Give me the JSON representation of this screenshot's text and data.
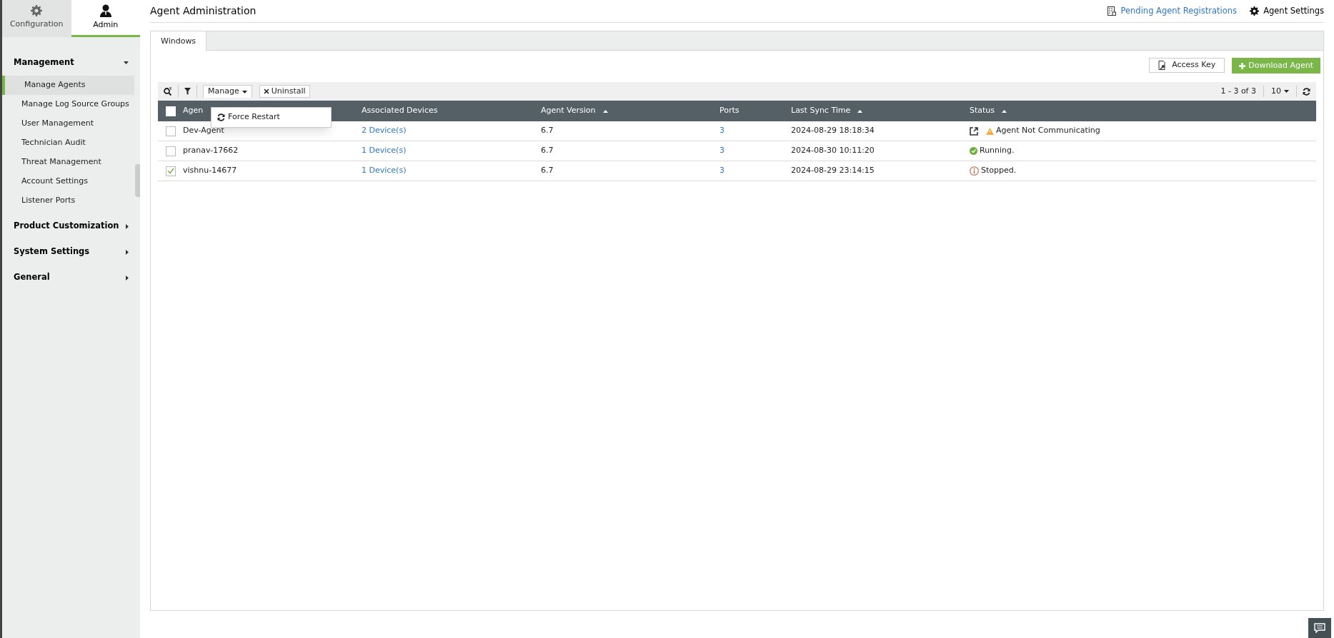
{
  "top_tabs": [
    {
      "label": "Configuration",
      "selected": false
    },
    {
      "label": "Admin",
      "selected": true
    }
  ],
  "sidebar": {
    "sections": [
      {
        "label": "Management",
        "expanded": true,
        "items": [
          {
            "label": "Manage Agents",
            "selected": true
          },
          {
            "label": "Manage Log Source Groups",
            "selected": false
          },
          {
            "label": "User Management",
            "selected": false
          },
          {
            "label": "Technician Audit",
            "selected": false
          },
          {
            "label": "Threat Management",
            "selected": false
          },
          {
            "label": "Account Settings",
            "selected": false
          },
          {
            "label": "Listener Ports",
            "selected": false
          }
        ]
      },
      {
        "label": "Product Customization",
        "expanded": false
      },
      {
        "label": "System Settings",
        "expanded": false
      },
      {
        "label": "General",
        "expanded": false
      }
    ]
  },
  "page_title": "Agent Administration",
  "header_links": [
    {
      "label": "Pending Agent Registrations",
      "kind": "link"
    },
    {
      "label": "Agent Settings",
      "kind": "settings"
    }
  ],
  "os_tabs": [
    {
      "label": "Windows",
      "selected": true
    }
  ],
  "buttons": [
    {
      "label": "Access Key",
      "kind": "secondary"
    },
    {
      "label": "Download Agent",
      "kind": "primary"
    }
  ],
  "toolbar": {
    "manage": "Manage",
    "uninstall": "Uninstall",
    "pagination": "1 - 3 of 3",
    "page_size": "10"
  },
  "manage_menu": [
    {
      "label": "Force Restart"
    }
  ],
  "table": {
    "all_checked": false,
    "columns": [
      {
        "label": "Agen",
        "sorted": false
      },
      {
        "label": "Associated Devices",
        "sorted": false
      },
      {
        "label": "Agent Version",
        "sorted": true
      },
      {
        "label": "Ports",
        "sorted": false
      },
      {
        "label": "Last Sync Time",
        "sorted": true
      },
      {
        "label": "Status",
        "sorted": true
      }
    ],
    "rows": [
      {
        "checked": false,
        "name": "Dev-Agent",
        "devices": "2 Device(s)",
        "version": "6.7",
        "ports": "3",
        "last_sync": "2024-08-29 18:18:34",
        "status": "Agent Not Communicating",
        "kind": "warning"
      },
      {
        "checked": false,
        "name": "pranav-17662",
        "devices": "1 Device(s)",
        "version": "6.7",
        "ports": "3",
        "last_sync": "2024-08-30 10:11:20",
        "status": "Running.",
        "kind": "running"
      },
      {
        "checked": true,
        "name": "vishnu-14677",
        "devices": "1 Device(s)",
        "version": "6.7",
        "ports": "3",
        "last_sync": "2024-08-29 23:14:15",
        "status": "Stopped.",
        "kind": "stopped"
      }
    ]
  }
}
